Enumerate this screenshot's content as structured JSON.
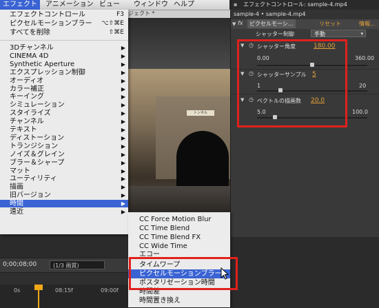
{
  "menubar": {
    "items": [
      "エフェクト",
      "アニメーション",
      "ビュー",
      "ウィンドウ",
      "ヘルプ"
    ]
  },
  "background": {
    "comp_title": "ジェクト *",
    "sign_text": "トンネル"
  },
  "effect_menu": {
    "top_items": [
      {
        "label": "エフェクトコントロール",
        "shortcut": "F3"
      },
      {
        "label": "ピクセルモーションブラー",
        "shortcut": "⌥⇧⌘E"
      },
      {
        "label": "すべてを削除",
        "shortcut": "⇧⌘E"
      }
    ],
    "categories": [
      "3Dチャンネル",
      "CINEMA 4D",
      "Synthetic Aperture",
      "エクスプレッション制御",
      "オーディオ",
      "カラー補正",
      "キーイング",
      "シミュレーション",
      "スタイライズ",
      "チャンネル",
      "テキスト",
      "ディストーション",
      "トランジション",
      "ノイズ＆グレイン",
      "ブラー＆シャープ",
      "マット",
      "ユーティリティ",
      "描画",
      "旧バージョン",
      "時間",
      "遠近"
    ],
    "highlighted": "時間"
  },
  "time_submenu": {
    "items": [
      "CC Force Motion Blur",
      "CC Time Blend",
      "CC Time Blend FX",
      "CC Wide Time",
      "エコー",
      "タイムワープ",
      "ピクセルモーションブラー",
      "ポスタリゼーション時間",
      "時間差",
      "時間置き換え"
    ],
    "highlighted": "ピクセルモーションブラー"
  },
  "timeline": {
    "timecode": "0;00;08;00",
    "resolution": "(1/3 画質)",
    "ticks": [
      "0s",
      "08:15f",
      "09:00f"
    ]
  },
  "effect_controls": {
    "title": "エフェクトコントロール: sample-4.mp4",
    "breadcrumb": "sample-4 • sample-4.mp4",
    "fx_label": "fx",
    "effect_name": "ピクセルモーシ...",
    "reset_label": "リセット",
    "info_label": "情報...",
    "shutter_control_label": "シャッター制御",
    "shutter_control_value": "手動",
    "shutter_angle": {
      "label": "シャッター角度",
      "value": "180.00",
      "min": "0.00",
      "max": "360.00",
      "fraction": 0.5
    },
    "shutter_samples": {
      "label": "シャッターサンプル",
      "value": "5",
      "min": "1",
      "max": "20",
      "fraction": 0.21
    },
    "vector_detail": {
      "label": "ベクトルの描画数",
      "value": "20.0",
      "min": "5.0",
      "max": "100.0",
      "fraction": 0.16
    }
  },
  "colors": {
    "highlight_blue": "#3a63d3",
    "accent_orange": "#e8a33a",
    "red_box": "#e0211c"
  }
}
